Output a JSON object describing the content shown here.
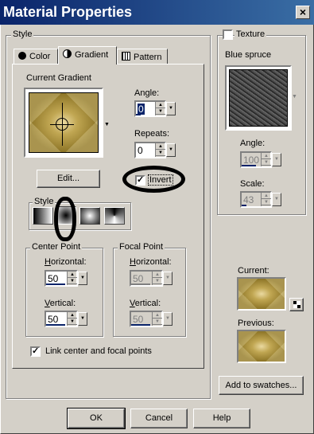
{
  "window": {
    "title": "Material Properties",
    "close_label": "×"
  },
  "style_group": {
    "label": "Style"
  },
  "tabs": [
    {
      "label": "Color",
      "icon": "color-dot-icon"
    },
    {
      "label": "Gradient",
      "icon": "gradient-half-icon"
    },
    {
      "label": "Pattern",
      "icon": "pattern-grid-icon"
    }
  ],
  "gradient": {
    "current_label": "Current Gradient",
    "edit_button": "Edit...",
    "angle_label": "Angle:",
    "angle_value": "0",
    "repeats_label": "Repeats:",
    "repeats_value": "0",
    "invert_label": "Invert",
    "invert_checked": true,
    "style_label": "Style",
    "style_options": [
      "linear",
      "rectangular",
      "sunburst",
      "radial"
    ],
    "selected_style": "rectangular"
  },
  "center_point": {
    "label": "Center Point",
    "horizontal_label": "Horizontal:",
    "horizontal_value": "50",
    "vertical_label": "Vertical:",
    "vertical_value": "50"
  },
  "focal_point": {
    "label": "Focal Point",
    "horizontal_label": "Horizontal:",
    "horizontal_value": "50",
    "vertical_label": "Vertical:",
    "vertical_value": "50"
  },
  "link_label": "Link center and focal points",
  "link_checked": true,
  "texture": {
    "label": "Texture",
    "checked": false,
    "name": "Blue spruce",
    "angle_label": "Angle:",
    "angle_value": "100",
    "scale_label": "Scale:",
    "scale_value": "43"
  },
  "current_label": "Current:",
  "previous_label": "Previous:",
  "add_swatches_button": "Add to swatches...",
  "buttons": {
    "ok": "OK",
    "cancel": "Cancel",
    "help": "Help"
  },
  "colors": {
    "title_start": "#0a246a",
    "title_end": "#3a6ea5",
    "face": "#d4d0c8",
    "annotation": "#000000"
  }
}
